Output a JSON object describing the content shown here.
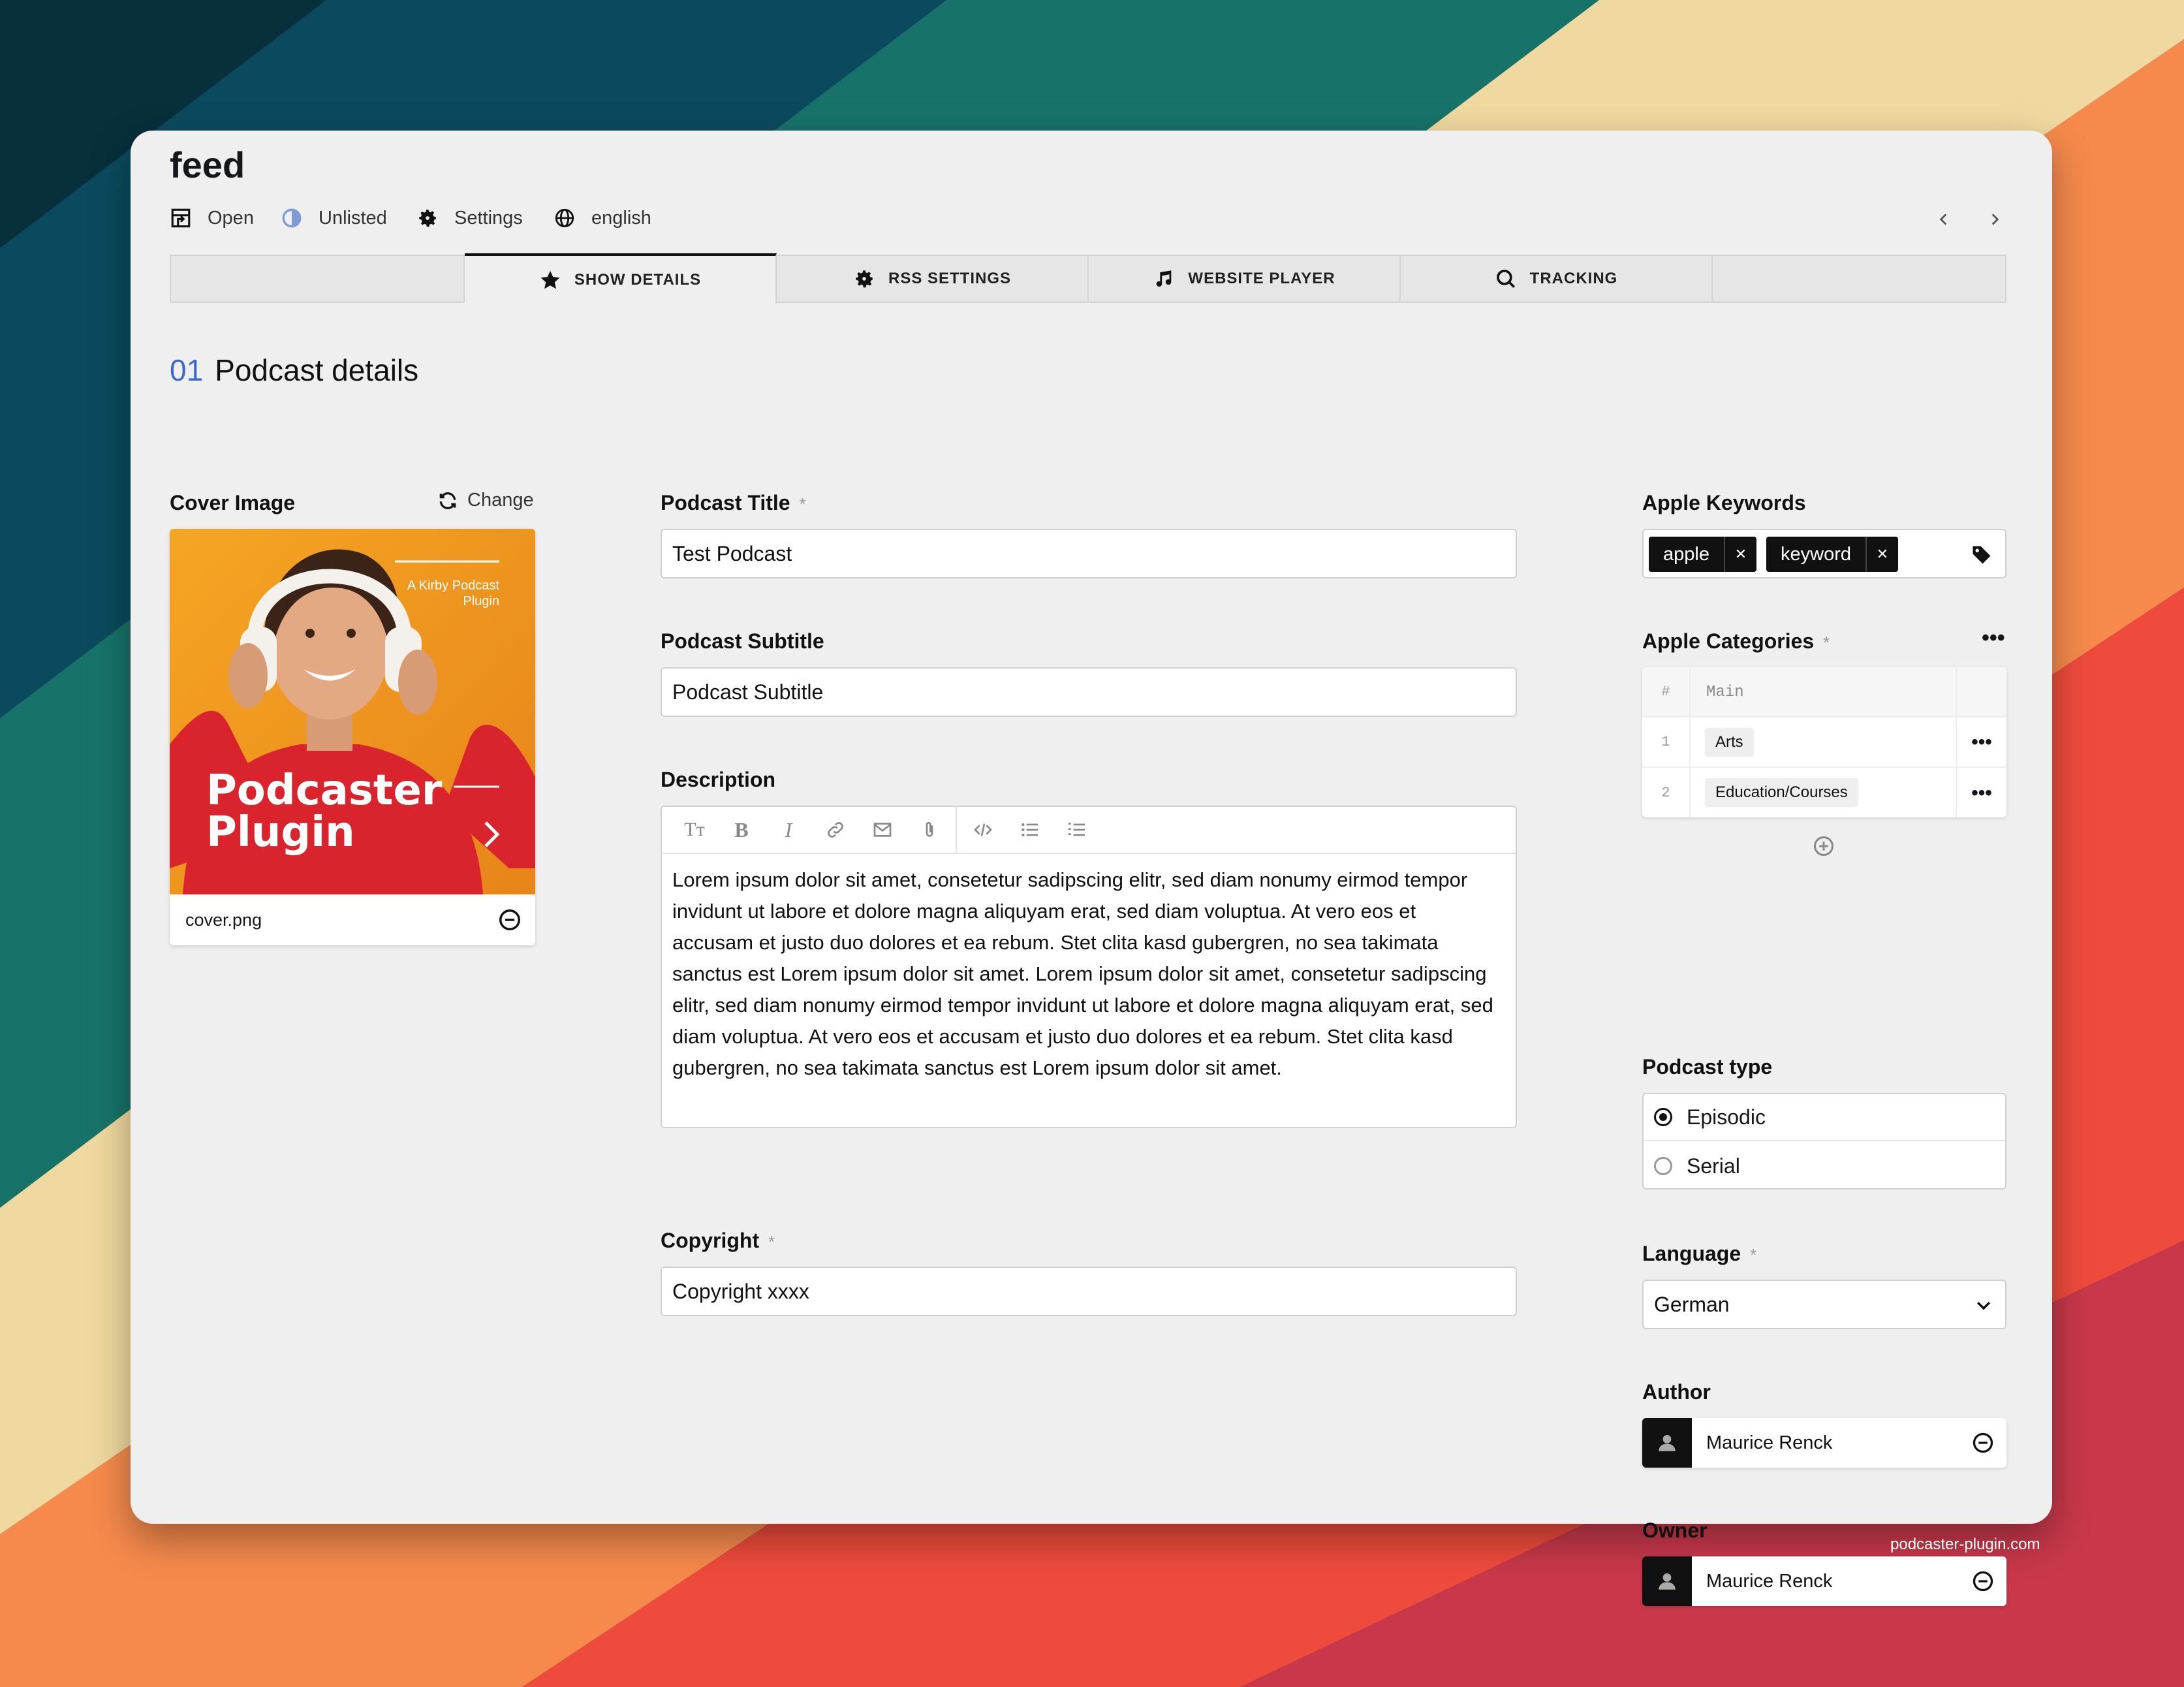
{
  "page": {
    "title": "feed",
    "footer_url": "podcaster-plugin.com"
  },
  "header": {
    "items": [
      {
        "label": "Open",
        "icon": "open-icon"
      },
      {
        "label": "Unlisted",
        "icon": "unlisted-icon"
      },
      {
        "label": "Settings",
        "icon": "gear-icon"
      },
      {
        "label": "english",
        "icon": "globe-icon"
      }
    ]
  },
  "tabs": [
    {
      "label": "SHOW DETAILS",
      "icon": "star-icon",
      "active": true
    },
    {
      "label": "RSS SETTINGS",
      "icon": "gear-icon",
      "active": false
    },
    {
      "label": "WEBSITE PLAYER",
      "icon": "music-note-icon",
      "active": false
    },
    {
      "label": "TRACKING",
      "icon": "search-icon",
      "active": false
    }
  ],
  "section": {
    "number": "01",
    "title": "Podcast details"
  },
  "cover": {
    "label": "Cover Image",
    "change_label": "Change",
    "filename": "cover.png",
    "image_tagline_1": "A Kirby Podcast",
    "image_tagline_2": "Plugin",
    "image_title_1": "Podcaster",
    "image_title_2": "Plugin"
  },
  "fields": {
    "title": {
      "label": "Podcast Title",
      "required": "*",
      "value": "Test Podcast"
    },
    "subtitle": {
      "label": "Podcast Subtitle",
      "value": "Podcast Subtitle"
    },
    "description": {
      "label": "Description",
      "value": "Lorem ipsum dolor sit amet, consetetur sadipscing elitr, sed diam nonumy eirmod tempor invidunt ut labore et dolore magna aliquyam erat, sed diam voluptua. At vero eos et accusam et justo duo dolores et ea rebum. Stet clita kasd gubergren, no sea takimata sanctus est Lorem ipsum dolor sit amet. Lorem ipsum dolor sit amet, consetetur sadipscing elitr, sed diam nonumy eirmod tempor invidunt ut labore et dolore magna aliquyam erat, sed diam voluptua. At vero eos et accusam et justo duo dolores et ea rebum. Stet clita kasd gubergren, no sea takimata sanctus est Lorem ipsum dolor sit amet."
    },
    "copyright": {
      "label": "Copyright",
      "required": "*",
      "value": "Copyright xxxx"
    }
  },
  "keywords": {
    "label": "Apple Keywords",
    "tags": [
      "apple",
      "keyword"
    ]
  },
  "categories": {
    "label": "Apple Categories",
    "required": "*",
    "header_index": "#",
    "header_col": "Main",
    "rows": [
      {
        "index": "1",
        "value": "Arts"
      },
      {
        "index": "2",
        "value": "Education/Courses"
      }
    ]
  },
  "podcast_type": {
    "label": "Podcast type",
    "options": [
      "Episodic",
      "Serial"
    ],
    "selected": "Episodic"
  },
  "language": {
    "label": "Language",
    "required": "*",
    "value": "German"
  },
  "author": {
    "label": "Author",
    "name": "Maurice Renck"
  },
  "owner": {
    "label": "Owner",
    "name": "Maurice Renck"
  },
  "colors": {
    "accent": "#3a6ad0",
    "dark": "#111111",
    "window_bg": "#efefef"
  }
}
